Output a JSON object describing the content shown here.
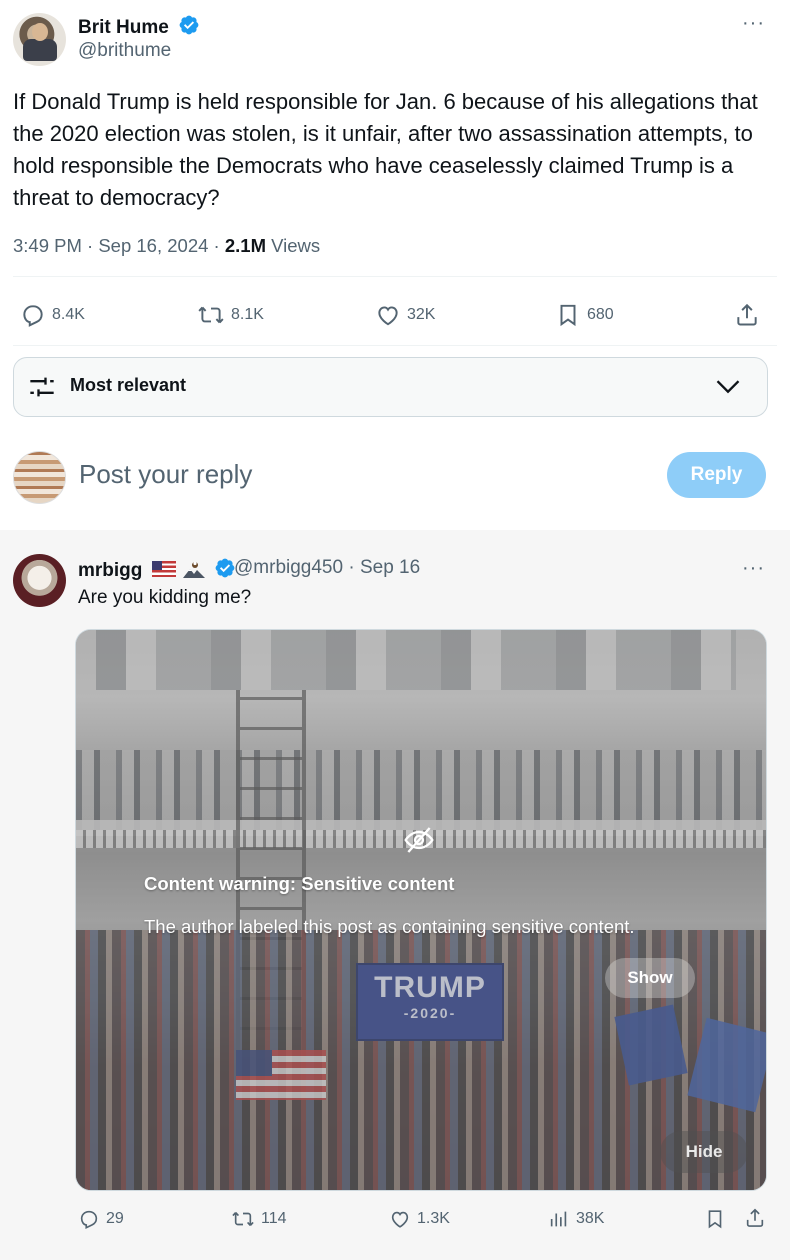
{
  "post": {
    "author_name": "Brit Hume",
    "author_handle": "@brithume",
    "more_label": "···",
    "text": "If Donald Trump is held responsible for Jan. 6 because of his allegations that the 2020 election was stolen, is it unfair, after two assassination attempts, to hold responsible the Democrats who have ceaselessly claimed Trump is a threat to democracy?",
    "time": "3:49 PM · Sep 16, 2024 · ",
    "views_count": "2.1M",
    "views_label": " Views",
    "stats": {
      "replies": "8.4K",
      "reposts": "8.1K",
      "likes": "32K",
      "bookmarks": "680"
    }
  },
  "sort": {
    "label": "Most relevant"
  },
  "composer": {
    "placeholder": "Post your reply",
    "button_label": "Reply"
  },
  "reply": {
    "author_name": "mrbigg",
    "author_handle": "@mrbigg450 · Sep 16",
    "more_label": "···",
    "text": "Are you kidding me?",
    "media": {
      "banner_line1": "TRUMP",
      "banner_line2": "-2020-",
      "warning_title": "Content warning: Sensitive content",
      "warning_desc": "The author labeled this post as containing sensitive content.",
      "show_label": "Show",
      "hide_label": "Hide"
    },
    "stats": {
      "replies": "29",
      "reposts": "114",
      "likes": "1.3K",
      "views": "38K"
    }
  },
  "colors": {
    "text_primary": "#0f1419",
    "text_secondary": "#536471",
    "verified": "#1d9bf0",
    "reply_button": "#8ecdf8"
  },
  "icons": [
    "verified-badge-icon",
    "more-icon",
    "reply-icon",
    "repost-icon",
    "like-icon",
    "bookmark-icon",
    "share-icon",
    "filter-sliders-icon",
    "chevron-down-icon",
    "eye-slash-icon",
    "views-chart-icon",
    "flag-us-icon",
    "eagle-mountain-icon"
  ]
}
